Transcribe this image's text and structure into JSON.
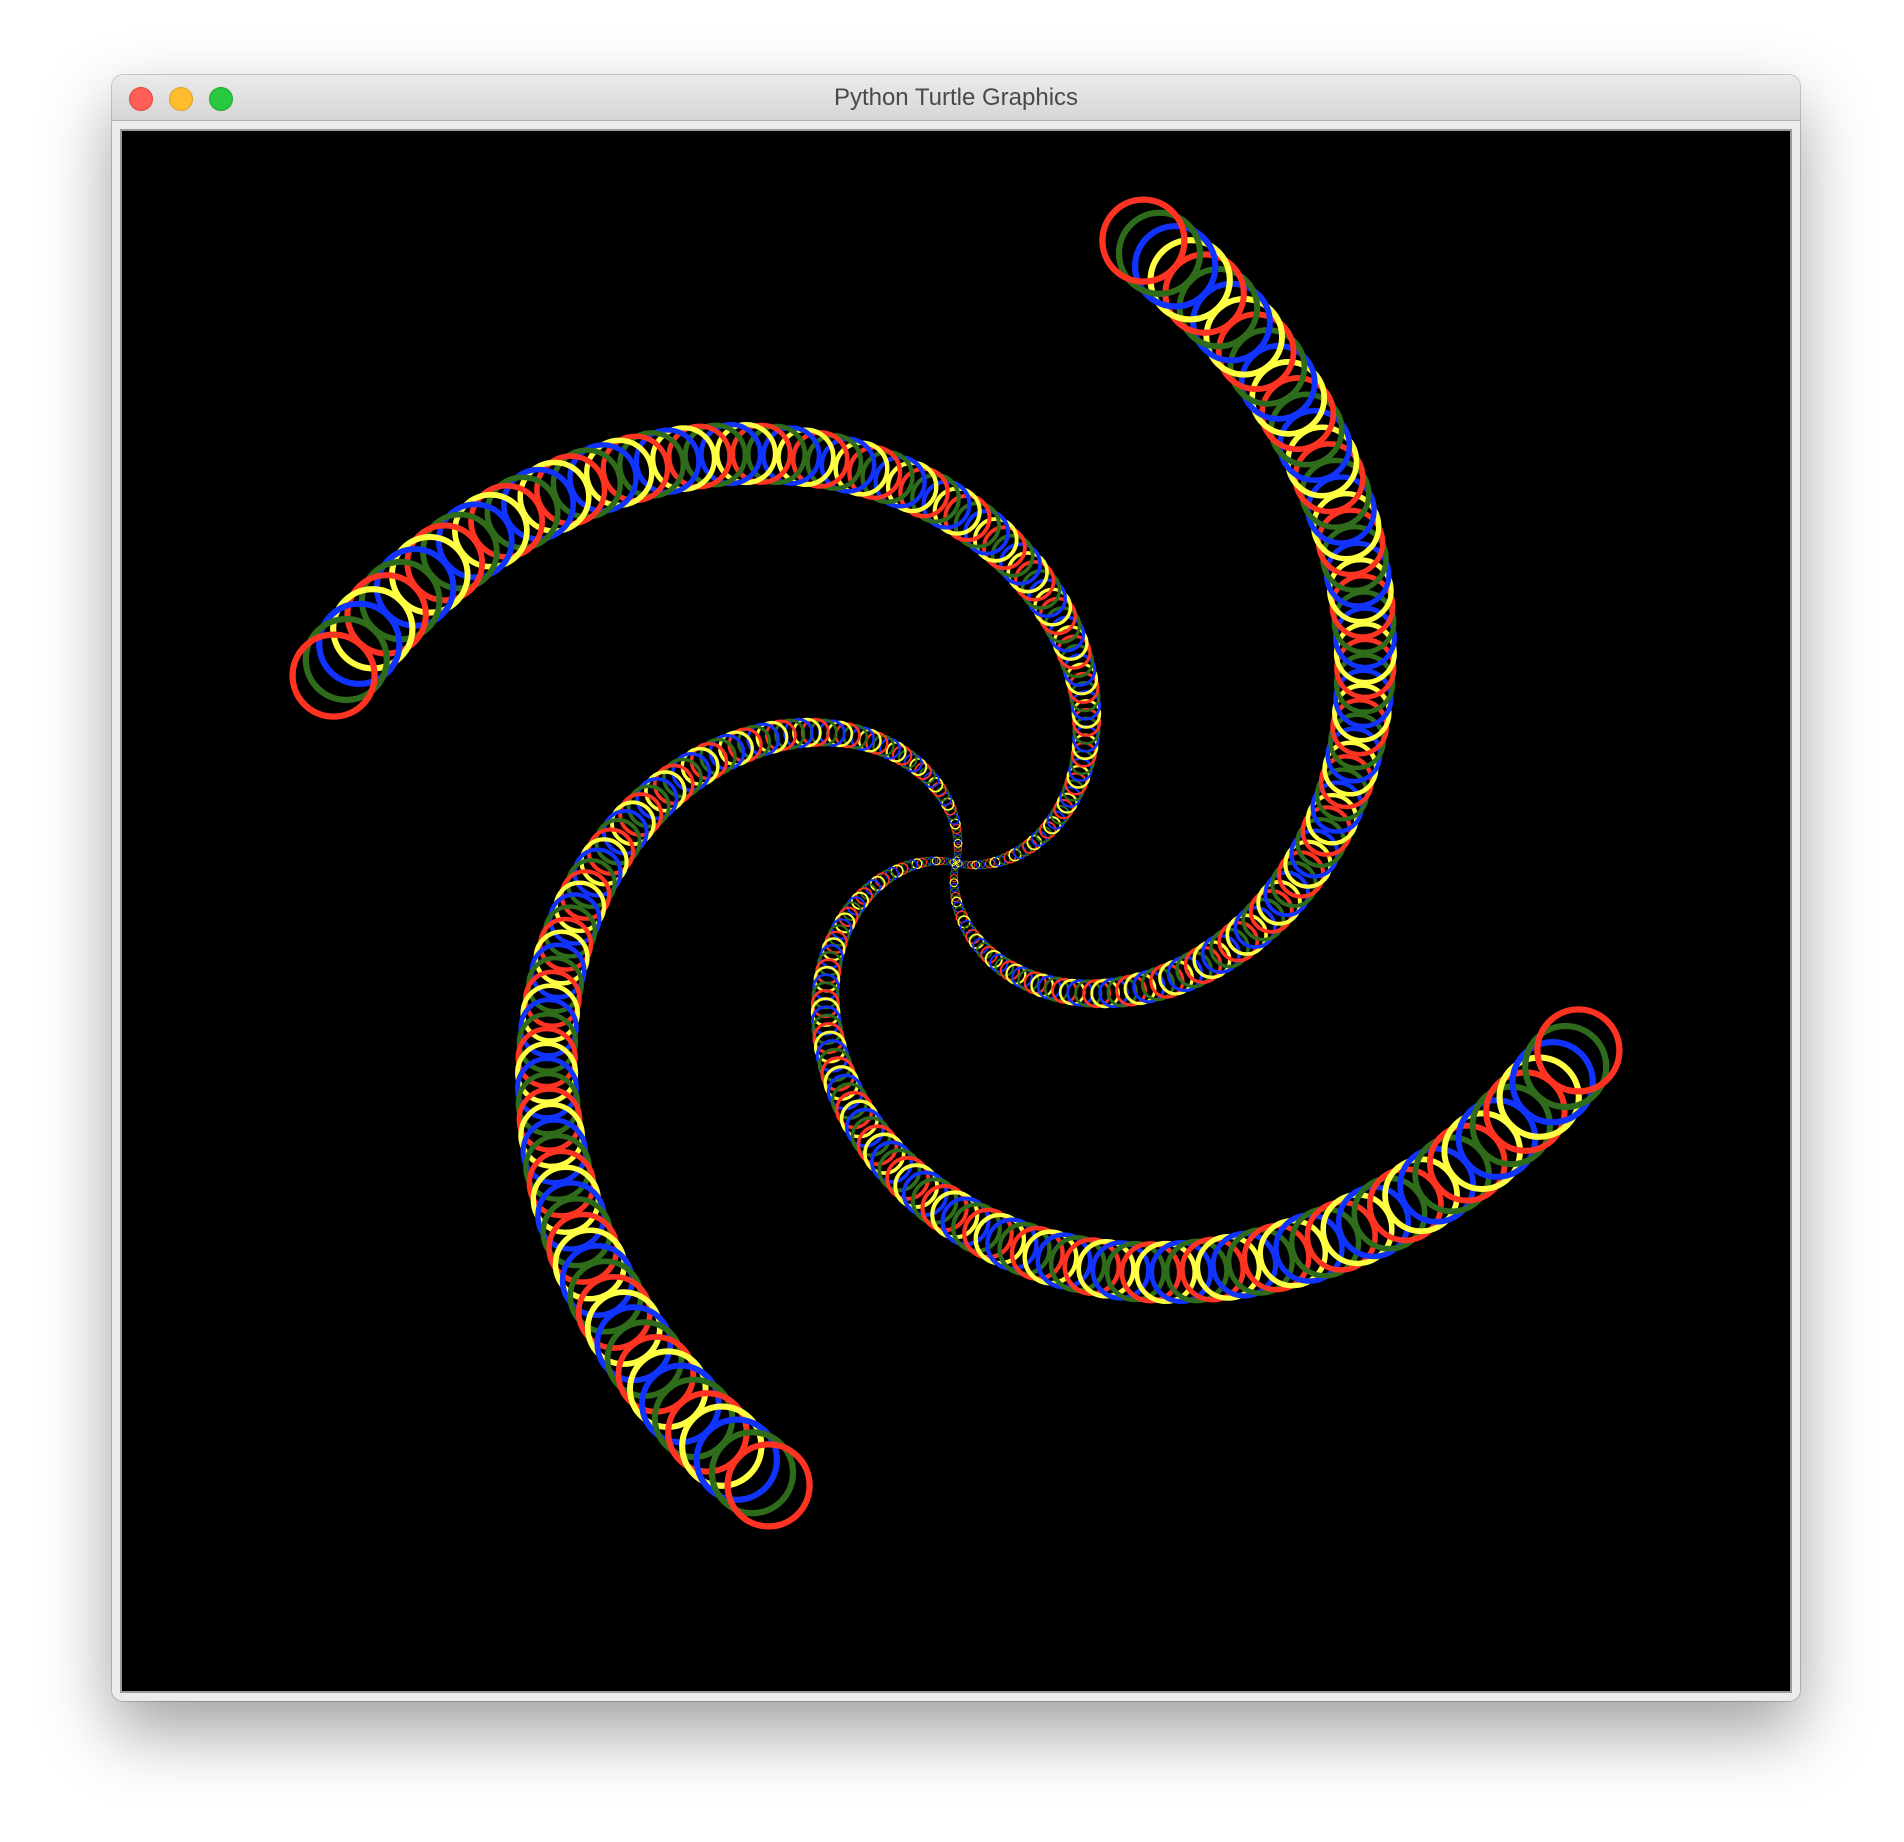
{
  "window": {
    "title": "Python Turtle Graphics"
  },
  "colors": {
    "canvas_background": "#000000",
    "pen_colors": [
      "#ff3322",
      "#ffff44",
      "#1133ff",
      "#2e6b1a"
    ]
  },
  "drawing": {
    "description_shapes": "circle outlines",
    "arms": 4,
    "color_order": [
      "red",
      "yellow",
      "blue",
      "green"
    ]
  }
}
